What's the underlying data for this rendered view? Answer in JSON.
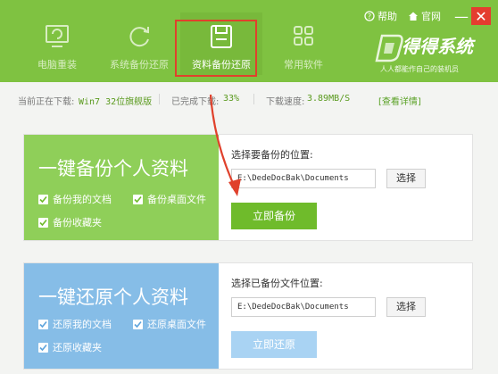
{
  "header": {
    "tabs": [
      {
        "label": "电脑重装",
        "icon": "monitor-icon",
        "state": "dim"
      },
      {
        "label": "系统备份还原",
        "icon": "refresh-icon",
        "state": "dim"
      },
      {
        "label": "资料备份还原",
        "icon": "floppy-disk-icon",
        "state": "active"
      },
      {
        "label": "常用软件",
        "icon": "grid-icon",
        "state": "dim"
      }
    ],
    "help_label": "帮助",
    "website_label": "官网",
    "minimize_symbol": "—",
    "close_symbol": "✕",
    "logo_text": "得得系统",
    "logo_slogan": "人人都能作自己的装机员"
  },
  "status": {
    "downloading_label": "当前正在下载:",
    "downloading_value": "Win7 32位旗舰版",
    "completed_label": "已完成下载:",
    "completed_value": "33%",
    "speed_label": "下载速度:",
    "speed_value": "3.89MB/S",
    "details_link": "[查看详情]"
  },
  "backup": {
    "title": "一键备份个人资料",
    "options": [
      "备份我的文档",
      "备份桌面文件",
      "备份收藏夹"
    ],
    "field_label": "选择要备份的位置:",
    "path_value": "E:\\DedeDocBak\\Documents",
    "browse_label": "选择",
    "action_label": "立即备份"
  },
  "restore": {
    "title": "一键还原个人资料",
    "options": [
      "还原我的文档",
      "还原桌面文件",
      "还原收藏夹"
    ],
    "field_label": "选择已备份文件位置:",
    "path_value": "E:\\DedeDocBak\\Documents",
    "browse_label": "选择",
    "action_label": "立即还原"
  },
  "colors": {
    "header_green": "#7fc241",
    "backup_card": "#8fcf59",
    "restore_card": "#86bde7",
    "backup_button": "#6fbb2b",
    "restore_button": "#a9d3f3",
    "highlight_red": "#e0412c",
    "close_red": "#e43d2f"
  }
}
